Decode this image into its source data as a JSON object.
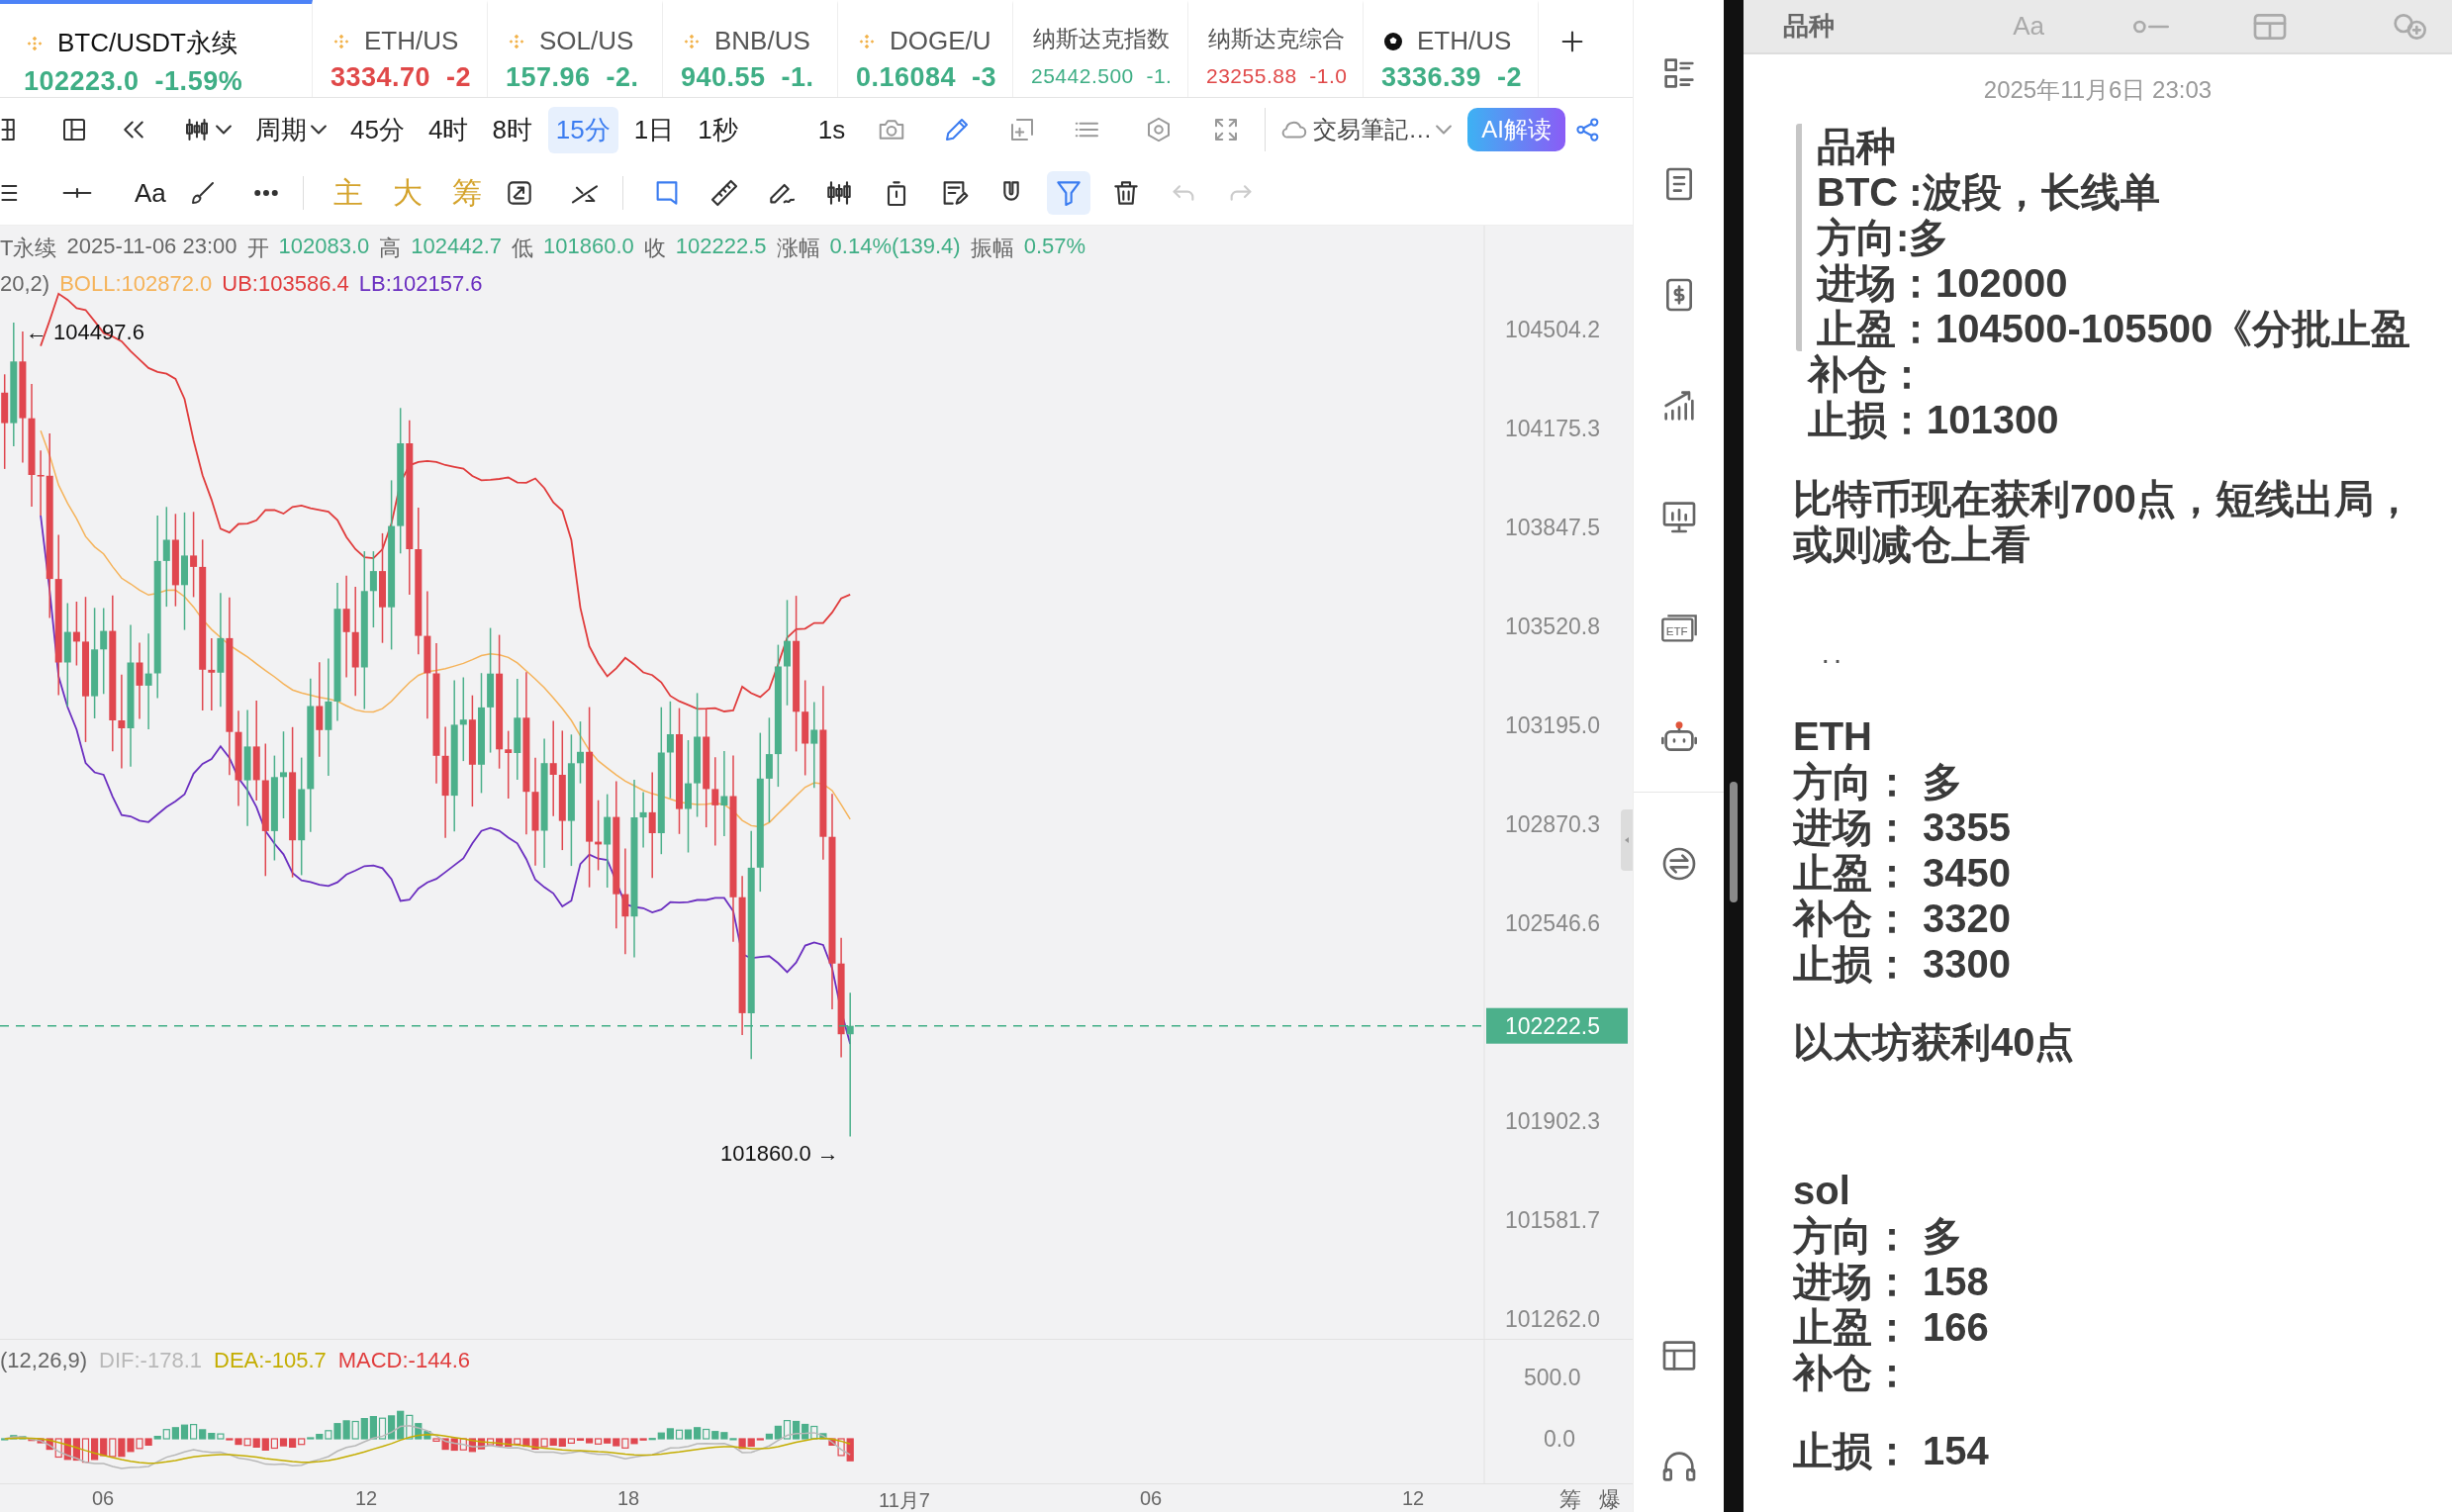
{
  "tabs": [
    {
      "kind": "coin",
      "symbol": "BTC/USDT永续",
      "price": "102223.0",
      "change": "-1.59%",
      "color": "#3fae85",
      "selected": true
    },
    {
      "kind": "coin",
      "symbol": "ETH/US",
      "price": "3334.70",
      "change": "-2",
      "color": "#e04848",
      "selected": false
    },
    {
      "kind": "coin",
      "symbol": "SOL/US",
      "price": "157.96",
      "change": "-2.",
      "color": "#3fae85",
      "selected": false
    },
    {
      "kind": "coin",
      "symbol": "BNB/US",
      "price": "940.55",
      "change": "-1.",
      "color": "#3fae85",
      "selected": false
    },
    {
      "kind": "coin",
      "symbol": "DOGE/U",
      "price": "0.16084",
      "change": "-3",
      "color": "#3fae85",
      "selected": false
    },
    {
      "kind": "index",
      "symbol": "纳斯达克指数",
      "price": "25442.500",
      "change": "-1.",
      "color": "#3fae85",
      "selected": false
    },
    {
      "kind": "index",
      "symbol": "纳斯达克综合",
      "price": "23255.88",
      "change": "-1.0",
      "color": "#e04848",
      "selected": false
    },
    {
      "kind": "token",
      "symbol": "ETH/US",
      "price": "3336.39",
      "change": "-2",
      "color": "#3fae85",
      "selected": false
    }
  ],
  "chart_toolbar": {
    "period_menu": "周期",
    "intervals": [
      {
        "label": "45分",
        "selected": false
      },
      {
        "label": "4时",
        "selected": false
      },
      {
        "label": "8时",
        "selected": false
      },
      {
        "label": "15分",
        "selected": true
      },
      {
        "label": "1日",
        "selected": false
      },
      {
        "label": "1秒",
        "selected": false
      }
    ],
    "second_button": "1s",
    "notes_menu": "交易筆記…",
    "ai_button": "AI解读"
  },
  "drawing_toolbar": {
    "text_tool": "Aa",
    "indicators": [
      "主",
      "大",
      "筹"
    ],
    "tools": [
      {
        "kind": "bookmark",
        "selected": false,
        "disabled": false
      },
      {
        "kind": "ruler",
        "selected": false,
        "disabled": false
      },
      {
        "kind": "penwave",
        "selected": false,
        "disabled": false
      },
      {
        "kind": "candles",
        "selected": false,
        "disabled": false
      },
      {
        "kind": "box",
        "selected": false,
        "disabled": false
      },
      {
        "kind": "note",
        "selected": false,
        "disabled": false
      },
      {
        "kind": "magnet",
        "selected": false,
        "disabled": false
      },
      {
        "kind": "filter",
        "selected": true,
        "disabled": false
      },
      {
        "kind": "trash",
        "selected": false,
        "disabled": false
      },
      {
        "kind": "undo",
        "selected": false,
        "disabled": true
      },
      {
        "kind": "redo",
        "selected": false,
        "disabled": true
      }
    ]
  },
  "info": {
    "symbol": "T永续",
    "time": "2025-11-06 23:00",
    "fields": [
      {
        "label": "开",
        "value": "102083.0"
      },
      {
        "label": "高",
        "value": "102442.7"
      },
      {
        "label": "低",
        "value": "101860.0"
      },
      {
        "label": "收",
        "value": "102222.5"
      },
      {
        "label": "涨幅",
        "value": "0.14%(139.4)"
      },
      {
        "label": "振幅",
        "value": "0.57%"
      }
    ]
  },
  "boll": {
    "params": "20,2)",
    "values": [
      {
        "text": "BOLL:102872.0",
        "color": "#f5b35a"
      },
      {
        "text": "UB:103586.4",
        "color": "#e03c3c"
      },
      {
        "text": "LB:102157.6",
        "color": "#6b2fc0"
      }
    ]
  },
  "chart": {
    "price_axis": [
      "104504.2",
      "104175.3",
      "103847.5",
      "103520.8",
      "103195.0",
      "102870.3",
      "102546.6",
      "101902.3",
      "101581.7",
      "101262.0"
    ],
    "last_price": "102222.5",
    "high_marker": "← 104497.6",
    "low_marker": "101860.0 →"
  },
  "macd": {
    "params": "(12,26,9)",
    "values": [
      {
        "text": "DIF:-178.1",
        "color": "#b8b8b8"
      },
      {
        "text": "DEA:-105.7",
        "color": "#c4ad00"
      },
      {
        "text": "MACD:-144.6",
        "color": "#e03c3c"
      }
    ],
    "axis": [
      "500.0",
      "0.0"
    ]
  },
  "time_axis": [
    "06",
    "12",
    "18",
    "11月7",
    "06",
    "12"
  ],
  "axis_buttons": [
    "筹",
    "爆"
  ],
  "sidebar": {
    "etf_label": "ETF"
  },
  "notes": {
    "toolbar_title": "品种",
    "format_button": "Aa",
    "timestamp": "2025年11月6日 23:03",
    "blocks": [
      {
        "kind": "quote",
        "lines": [
          "品种",
          "BTC :波段，长线单",
          "方向:多",
          "进场：102000",
          "止盈：104500-105500《分批止盈"
        ]
      },
      {
        "kind": "list",
        "lines": [
          "补仓：",
          "止损：101300"
        ]
      },
      {
        "kind": "plain",
        "lines": [
          "比特币现在获利700点，短线出局，",
          "或则减仓上看"
        ]
      },
      {
        "kind": "dots",
        "lines": [
          "·   ·"
        ]
      },
      {
        "kind": "plain",
        "lines": [
          "ETH",
          "方向： 多",
          "进场： 3355",
          "止盈： 3450",
          "补仓： 3320",
          "止损： 3300"
        ]
      },
      {
        "kind": "plain",
        "lines": [
          "以太坊获利40点"
        ]
      },
      {
        "kind": "plain",
        "lines": [
          "sol",
          "方向： 多",
          "进场： 158",
          "止盈： 166",
          "补仓："
        ]
      },
      {
        "kind": "plain",
        "lines": [
          "止损： 154"
        ]
      }
    ]
  }
}
